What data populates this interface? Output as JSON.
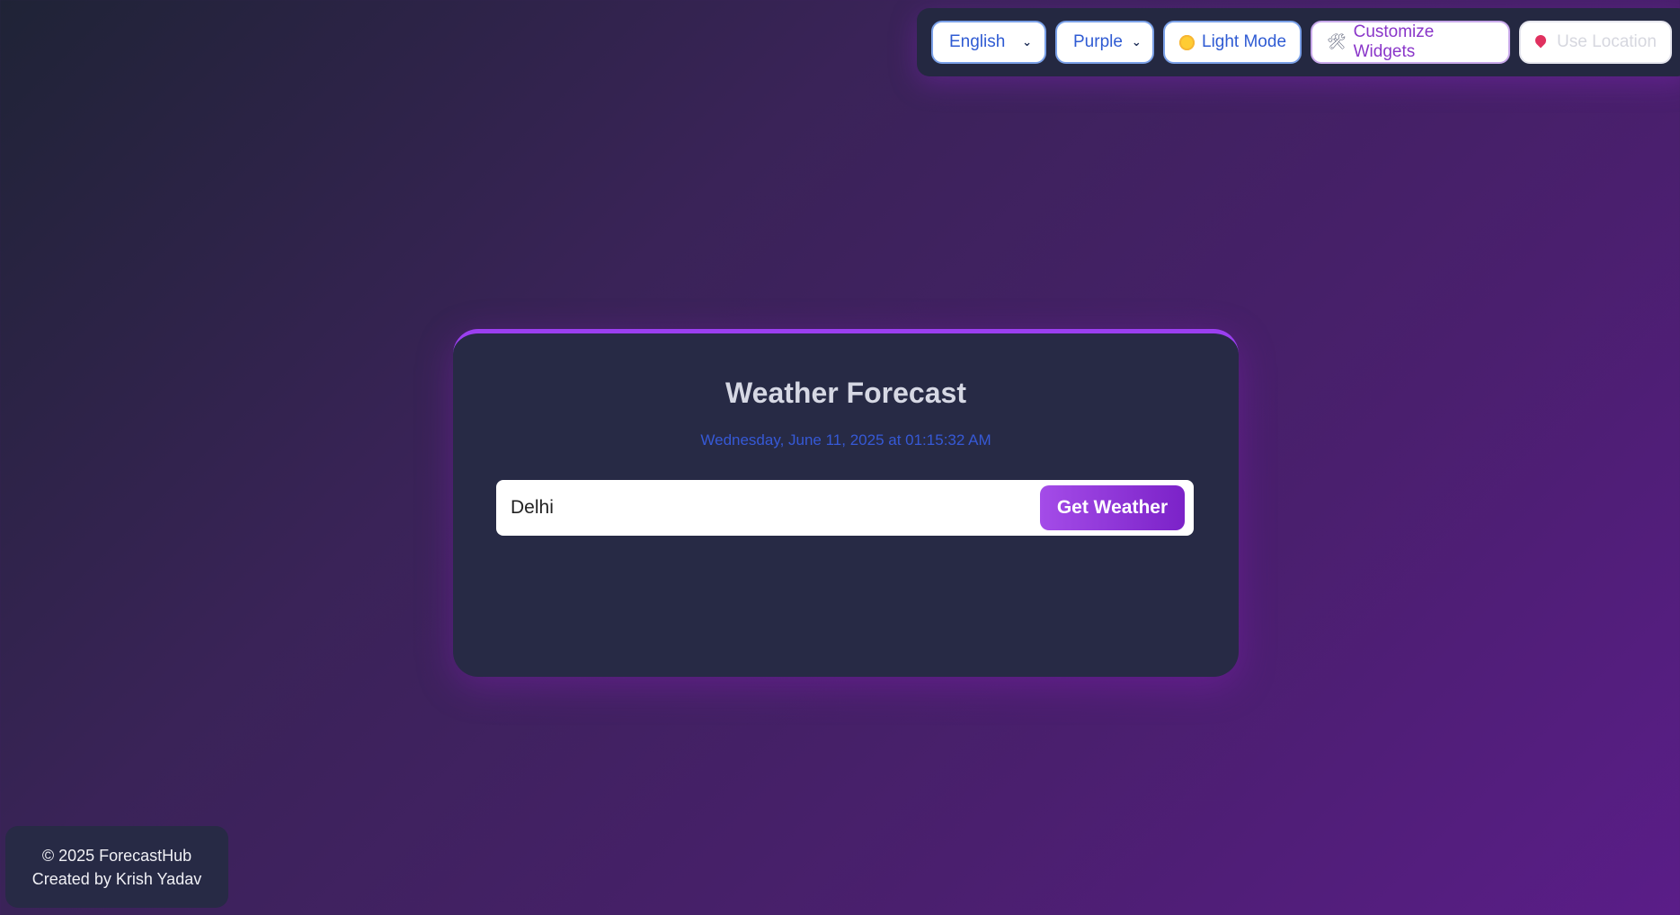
{
  "toolbar": {
    "language": {
      "selected": "English"
    },
    "theme": {
      "selected": "Purple"
    },
    "light_mode": {
      "icon": "sun-icon",
      "label": "Light Mode"
    },
    "customize": {
      "icon": "wrench-icon",
      "label": "Customize Widgets"
    },
    "location": {
      "icon": "pin-icon",
      "label": "Use Location"
    }
  },
  "card": {
    "title": "Weather Forecast",
    "datetime": "Wednesday, June 11, 2025 at 01:15:32 AM",
    "search": {
      "value": "Delhi"
    },
    "button_label": "Get Weather"
  },
  "footer": {
    "copyright": "© 2025 ForecastHub",
    "credit": "Created by Krish Yadav"
  },
  "colors": {
    "accent": "#9b3ff0",
    "card_bg": "#272a45",
    "date_text": "#3659d6",
    "button_gradient": [
      "#a44ce8",
      "#7b22c8"
    ]
  }
}
